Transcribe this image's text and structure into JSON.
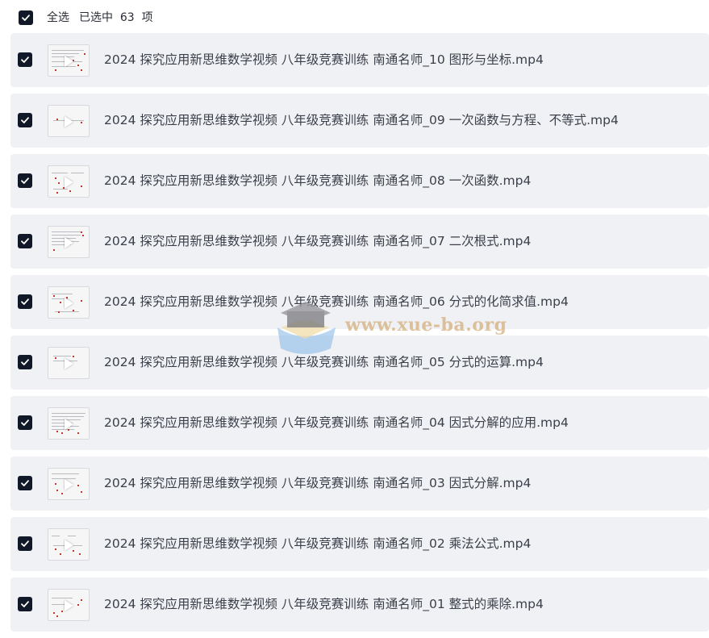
{
  "header": {
    "select_all_label": "全选",
    "selected_text": "已选中  63  项"
  },
  "files": [
    {
      "name": "2024 探究应用新思维数学视频 八年级竞赛训练 南通名师_10 图形与坐标.mp4",
      "checked": true
    },
    {
      "name": "2024 探究应用新思维数学视频 八年级竞赛训练 南通名师_09 一次函数与方程、不等式.mp4",
      "checked": true
    },
    {
      "name": "2024 探究应用新思维数学视频 八年级竞赛训练 南通名师_08 一次函数.mp4",
      "checked": true
    },
    {
      "name": "2024 探究应用新思维数学视频 八年级竞赛训练 南通名师_07 二次根式.mp4",
      "checked": true
    },
    {
      "name": "2024 探究应用新思维数学视频 八年级竞赛训练 南通名师_06 分式的化简求值.mp4",
      "checked": true
    },
    {
      "name": "2024 探究应用新思维数学视频 八年级竞赛训练 南通名师_05 分式的运算.mp4",
      "checked": true
    },
    {
      "name": "2024 探究应用新思维数学视频 八年级竞赛训练 南通名师_04 因式分解的应用.mp4",
      "checked": true
    },
    {
      "name": "2024 探究应用新思维数学视频 八年级竞赛训练 南通名师_03 因式分解.mp4",
      "checked": true
    },
    {
      "name": "2024 探究应用新思维数学视频 八年级竞赛训练 南通名师_02 乘法公式.mp4",
      "checked": true
    },
    {
      "name": "2024 探究应用新思维数学视频 八年级竞赛训练 南通名师_01 整式的乘除.mp4",
      "checked": true
    }
  ],
  "watermark": {
    "text": "www.xue-ba.org"
  },
  "colors": {
    "checkbox": "#111827",
    "row_bg": "#f0f1f4",
    "text": "#3b3f49"
  },
  "icons": {
    "checkbox": "checkmark-icon",
    "thumbnail_play": "play-icon"
  }
}
